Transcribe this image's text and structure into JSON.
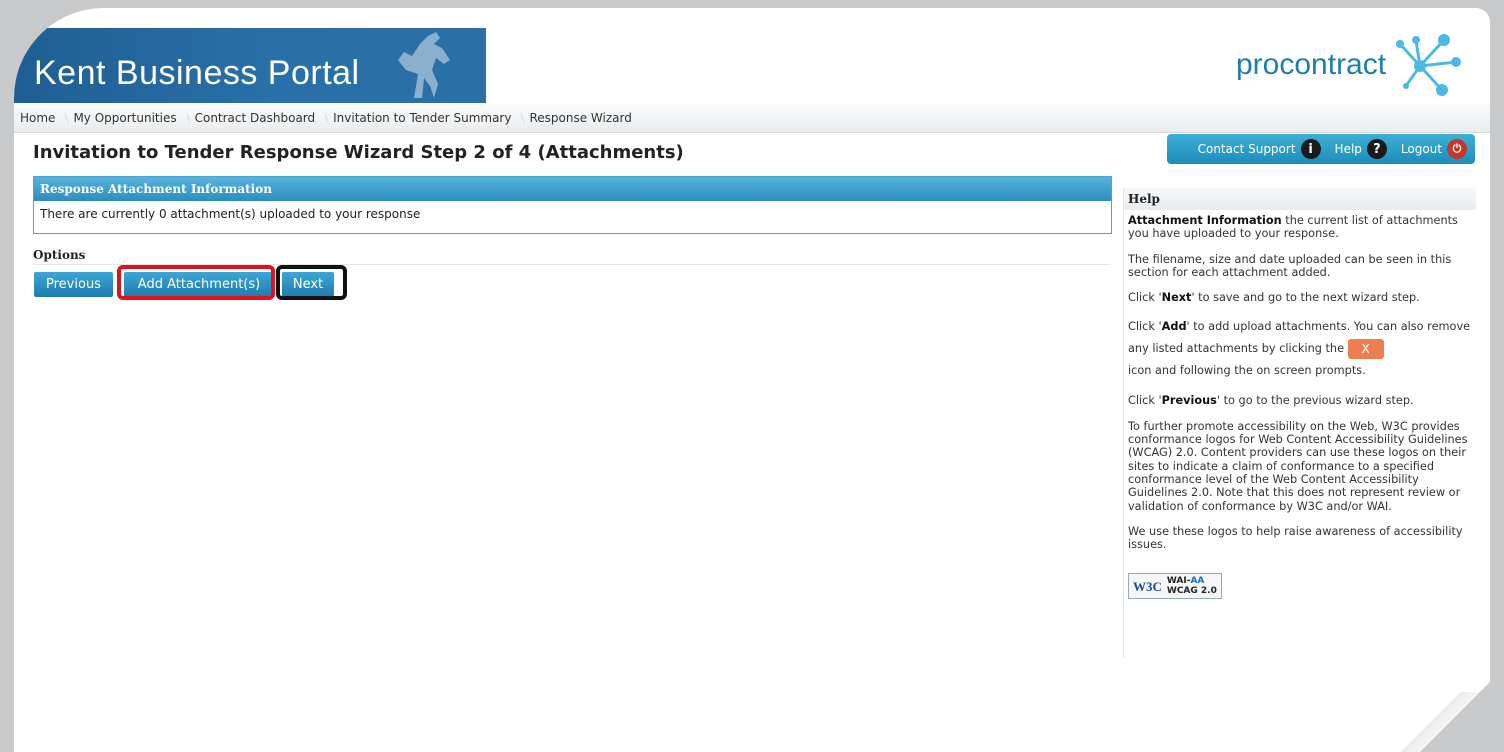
{
  "banner": {
    "title": "Kent Business Portal"
  },
  "logo": {
    "text": "procontract"
  },
  "breadcrumb": [
    "Home",
    "My Opportunities",
    "Contract Dashboard",
    "Invitation to Tender Summary",
    "Response Wizard"
  ],
  "page_title": "Invitation to Tender Response Wizard Step 2 of 4 (Attachments)",
  "support": {
    "contact_label": "Contact Support",
    "help_label": "Help",
    "logout_label": "Logout"
  },
  "panel": {
    "header": "Response Attachment Information",
    "body": "There are currently 0 attachment(s) uploaded to your response"
  },
  "options": {
    "label": "Options",
    "previous": "Previous",
    "add": "Add Attachment(s)",
    "next": "Next"
  },
  "help": {
    "header": "Help",
    "p1_bold": "Attachment Information",
    "p1_text": " the current list of attachments you have uploaded to your response.",
    "p2": "The filename, size and date uploaded can be seen in this section for each attachment added.",
    "p3_pre": "Click '",
    "p3_bold": "Next",
    "p3_post": "' to save and go to the next wizard step.",
    "p4_pre": "Click '",
    "p4_bold": "Add",
    "p4_post": "' to add upload attachments. You can also remove any listed attachments by clicking the",
    "p4_x": "X",
    "p4_end": "icon and following the on screen prompts.",
    "p5_pre": "Click '",
    "p5_bold": "Previous",
    "p5_post": "' to go to the previous wizard step.",
    "p6": "To further promote accessibility on the Web, W3C provides conformance logos for Web Content Accessibility Guidelines (WCAG) 2.0. Content providers can use these logos on their sites to indicate a claim of conformance to a specified conformance level of the Web Content Accessibility Guidelines 2.0. Note that this does not represent review or validation of conformance by W3C and/or WAI.",
    "p7": "We use these logos to help raise awareness of accessibility issues.",
    "badge_w3c": "W3C",
    "badge_wai": "WAI-",
    "badge_aa": "AA",
    "badge_wcag": "WCAG 2.0"
  },
  "colors": {
    "accent": "#2b8ec0",
    "highlight_red": "#e0111b",
    "highlight_black": "#111111",
    "remove": "#ef7d52"
  }
}
